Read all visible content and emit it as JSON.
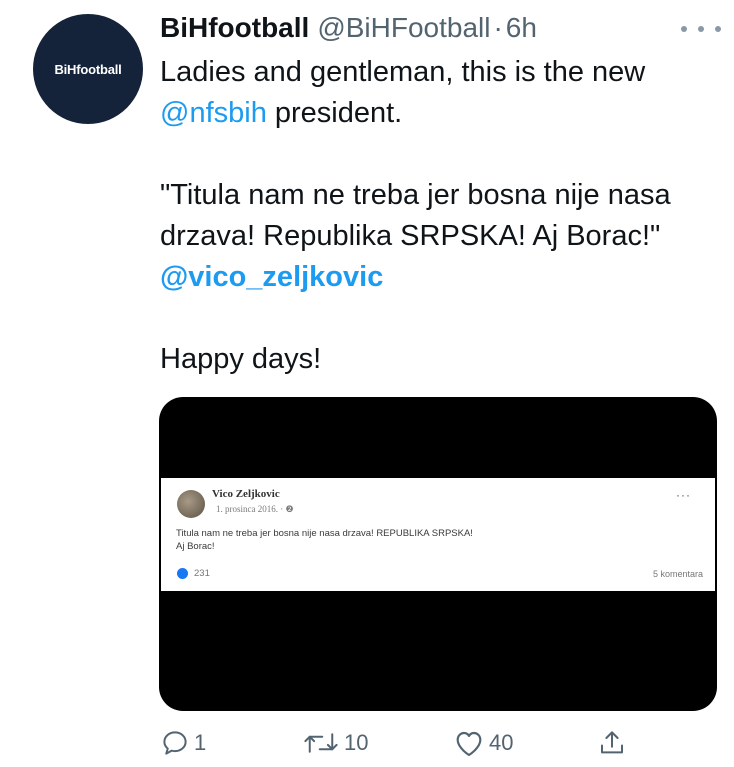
{
  "account": {
    "avatar_logo": "BiHfootball",
    "display_name": "BiHfootball",
    "handle": "@BiHFootball",
    "separator": "·",
    "time_ago": "6h"
  },
  "tweet": {
    "line1_prefix": "Ladies and gentleman, this is the new ",
    "mention1": "@nfsbih",
    "line1_suffix": " president.",
    "quote_text": "\"Titula nam ne treba jer bosna nije nasa drzava! Republika SRPSKA! Aj Borac!\" ",
    "mention2": "@vico_zeljkovic",
    "closing": "Happy days!"
  },
  "embedded_post": {
    "author": "Vico Zeljkovic",
    "date": "1. prosinca 2016. · ❷",
    "text_line1": "Titula nam ne treba jer bosna nije nasa drzava! REPUBLIKA SRPSKA!",
    "text_line2": "Aj Borac!",
    "likes": "231",
    "comments": "5 komentara"
  },
  "actions": {
    "replies": "1",
    "retweets": "10",
    "likes": "40"
  },
  "colors": {
    "link": "#1d9bf0",
    "secondary": "#536471",
    "avatar_bg": "#14233a"
  },
  "icons": [
    "more-icon",
    "reply-icon",
    "retweet-icon",
    "like-icon",
    "share-icon"
  ]
}
